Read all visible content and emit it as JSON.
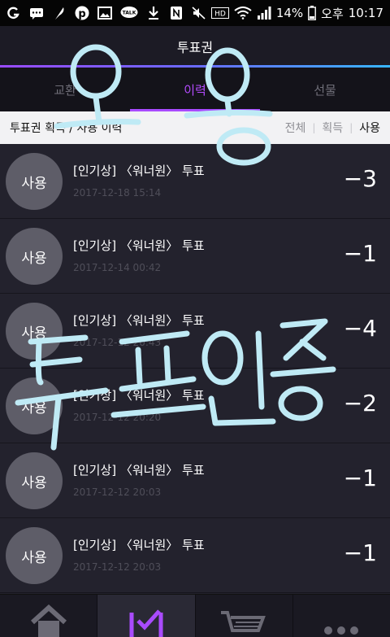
{
  "status_bar": {
    "battery": "14%",
    "ampm": "오후",
    "time": "10:17",
    "hd_label": "HD",
    "talk_label": "TALK",
    "left_icons": [
      "signal-g-icon",
      "chat-icon",
      "feather-icon",
      "pinterest-icon",
      "image-icon",
      "kakaotalk-icon",
      "download-icon",
      "nfc-icon"
    ],
    "right_icons": [
      "mute-icon",
      "hd-icon",
      "wifi-icon",
      "cell-signal-icon",
      "battery-icon"
    ]
  },
  "header": {
    "title": "투표권"
  },
  "tabs": [
    {
      "label": "교환",
      "active": false
    },
    {
      "label": "이력",
      "active": true
    },
    {
      "label": "선물",
      "active": false
    }
  ],
  "subheader": {
    "label": "투표권 획득 / 사용 이력",
    "filters": [
      "전체",
      "획득",
      "사용"
    ],
    "active_filter": "사용"
  },
  "history": [
    {
      "badge": "사용",
      "title": "[인기상] 〈워너원〉 투표",
      "date": "2017-12-18 15:14",
      "amount": "−3"
    },
    {
      "badge": "사용",
      "title": "[인기상] 〈워너원〉 투표",
      "date": "2017-12-14 00:42",
      "amount": "−1"
    },
    {
      "badge": "사용",
      "title": "[인기상] 〈워너원〉 투표",
      "date": "2017-12-12 20:43",
      "amount": "−4"
    },
    {
      "badge": "사용",
      "title": "[인기상] 〈워너원〉 투표",
      "date": "2017-12-12 20:20",
      "amount": "−2"
    },
    {
      "badge": "사용",
      "title": "[인기상] 〈워너원〉 투표",
      "date": "2017-12-12 20:03",
      "amount": "−1"
    },
    {
      "badge": "사용",
      "title": "[인기상] 〈워너원〉 투표",
      "date": "2017-12-12 20:03",
      "amount": "−1"
    }
  ],
  "bottom_nav": [
    {
      "icon": "home-icon",
      "active": false
    },
    {
      "icon": "vote-check-icon",
      "active": true
    },
    {
      "icon": "cart-icon",
      "active": false
    },
    {
      "icon": "more-icon",
      "active": false
    }
  ],
  "handwriting": {
    "line1": "오 옹",
    "line2": "투표인증",
    "color": "#bfeaf5"
  },
  "colors": {
    "accent": "#a94bff",
    "background": "#23222d",
    "subheader_bg": "#f2f2f4"
  }
}
